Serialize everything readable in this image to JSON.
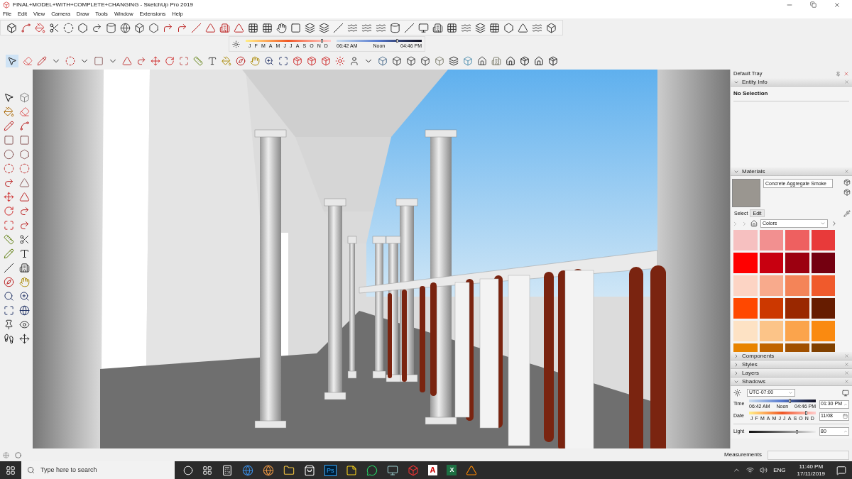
{
  "window": {
    "title": "FINAL+MODEL+WITH+COMPLETE+CHANGING - SketchUp Pro 2019"
  },
  "menu": [
    "File",
    "Edit",
    "View",
    "Camera",
    "Draw",
    "Tools",
    "Window",
    "Extensions",
    "Help"
  ],
  "shadow_toolbar": {
    "months": [
      "J",
      "F",
      "M",
      "A",
      "M",
      "J",
      "J",
      "A",
      "S",
      "O",
      "N",
      "D"
    ],
    "date_slider": {
      "level": 0.9
    },
    "time_labels": [
      "06:42 AM",
      "Noon",
      "04:46 PM"
    ],
    "time_slider": {
      "level": 0.72
    }
  },
  "tray": {
    "title": "Default Tray",
    "panels": [
      {
        "title": "Entity Info",
        "expanded": true,
        "kind": "entity",
        "text": "No Selection"
      },
      {
        "title": "Materials",
        "expanded": true,
        "kind": "materials",
        "material_name": "Concrete Aggregate Smoke",
        "tabs": [
          {
            "label": "Select",
            "selected": true
          },
          {
            "label": "Edit",
            "selected": false
          }
        ],
        "library": "Colors",
        "swatches": [
          {
            "color": "#f6c0c0"
          },
          {
            "color": "#f29090"
          },
          {
            "color": "#ee6060"
          },
          {
            "color": "#e83a3a"
          },
          {
            "color": "#ff0000"
          },
          {
            "color": "#c80010"
          },
          {
            "color": "#9c0010"
          },
          {
            "color": "#740010"
          },
          {
            "color": "#fcd4c4"
          },
          {
            "color": "#f8aa8c"
          },
          {
            "color": "#f48458"
          },
          {
            "color": "#f05a2c"
          },
          {
            "color": "#ff4800"
          },
          {
            "color": "#cc3800"
          },
          {
            "color": "#9a2800"
          },
          {
            "color": "#661c00"
          },
          {
            "color": "#fde2c4"
          },
          {
            "color": "#fcc488"
          },
          {
            "color": "#fba44c"
          },
          {
            "color": "#fa8a10"
          },
          {
            "color": "#e88400"
          },
          {
            "color": "#c06400"
          },
          {
            "color": "#a05000"
          },
          {
            "color": "#804000"
          }
        ]
      },
      {
        "title": "Components",
        "expanded": false
      },
      {
        "title": "Styles",
        "expanded": false
      },
      {
        "title": "Layers",
        "expanded": false
      },
      {
        "title": "Shadows",
        "expanded": true,
        "kind": "shadows",
        "timezone": "UTC-07:00",
        "time_label": "Time",
        "time_scale": [
          "06:42 AM",
          "Noon",
          "04:46 PM"
        ],
        "time_slider": {
          "level": 0.62
        },
        "time_value": "01:30 PM",
        "date_label": "Date",
        "months": [
          "J",
          "F",
          "M",
          "A",
          "M",
          "J",
          "J",
          "A",
          "S",
          "O",
          "N",
          "D"
        ],
        "date_slider": {
          "level": 0.86
        },
        "date_value": "11/08",
        "light_label": "Light",
        "light_slider": {
          "level": 0.72
        },
        "light_value": "80"
      }
    ]
  },
  "status_bar": {
    "measurements_label": "Measurements"
  },
  "taskbar": {
    "search_placeholder": "Type here to search",
    "app_letters": [
      "Ps",
      "A",
      "X"
    ],
    "language": "ENG",
    "time": "11:40 PM",
    "date": "17/11/2019"
  }
}
